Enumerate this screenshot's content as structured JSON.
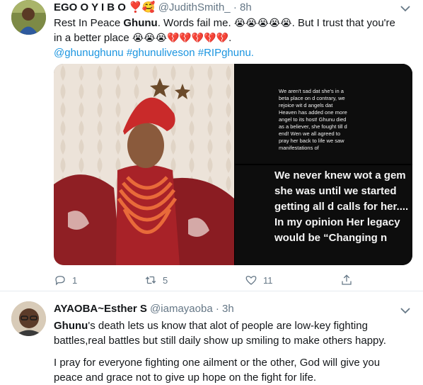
{
  "tweet1": {
    "name": "EGO O Y I B O",
    "name_emoji": "❣️🥰",
    "handle": "@JudithSmith_",
    "separator": "·",
    "time": "8h",
    "line1_a": "Rest In Peace ",
    "line1_bold": "Ghunu",
    "line1_b": ".  Words fail me. ",
    "line1_emoji": "😭😭😭😭😭",
    "line1_c": ". But I trust that you're",
    "line2_a": "in a better place ",
    "line2_emoji": "😭😭😭💔💔💔💔💔",
    "line2_b": ".",
    "hashtags": "@ghunughunu #ghunuliveson #RIPghunu.",
    "screenshot1_text": "We aren't sad dat she's in a beta place on d contrary, we rejoice wit d angels dat Heaven has added one more angel to its host! Ghunu died as a believer, she fought till d end! Wen we all agreed to pray her back to life we saw manifestations of",
    "screenshot2_text": "We never knew wot a gem she was until we started getting all d calls for her.... In my opinion Her legacy would be “Changing n",
    "replies": "1",
    "retweets": "5",
    "likes": "11"
  },
  "tweet2": {
    "name": "AYAOBA~Esther S",
    "handle": "@iamayaoba",
    "separator": "·",
    "time": "3h",
    "para1_bold": "Ghunu",
    "para1_rest": "'s death lets us know that alot of people are low-key fighting battles,real battles but still daily show up smiling to make others happy.",
    "para2": "I pray for everyone fighting one ailment or the other, God will give you peace and grace not to give up hope on the fight for life."
  },
  "icons": [
    "caret-down-icon",
    "reply-icon",
    "retweet-icon",
    "like-icon",
    "share-icon"
  ]
}
